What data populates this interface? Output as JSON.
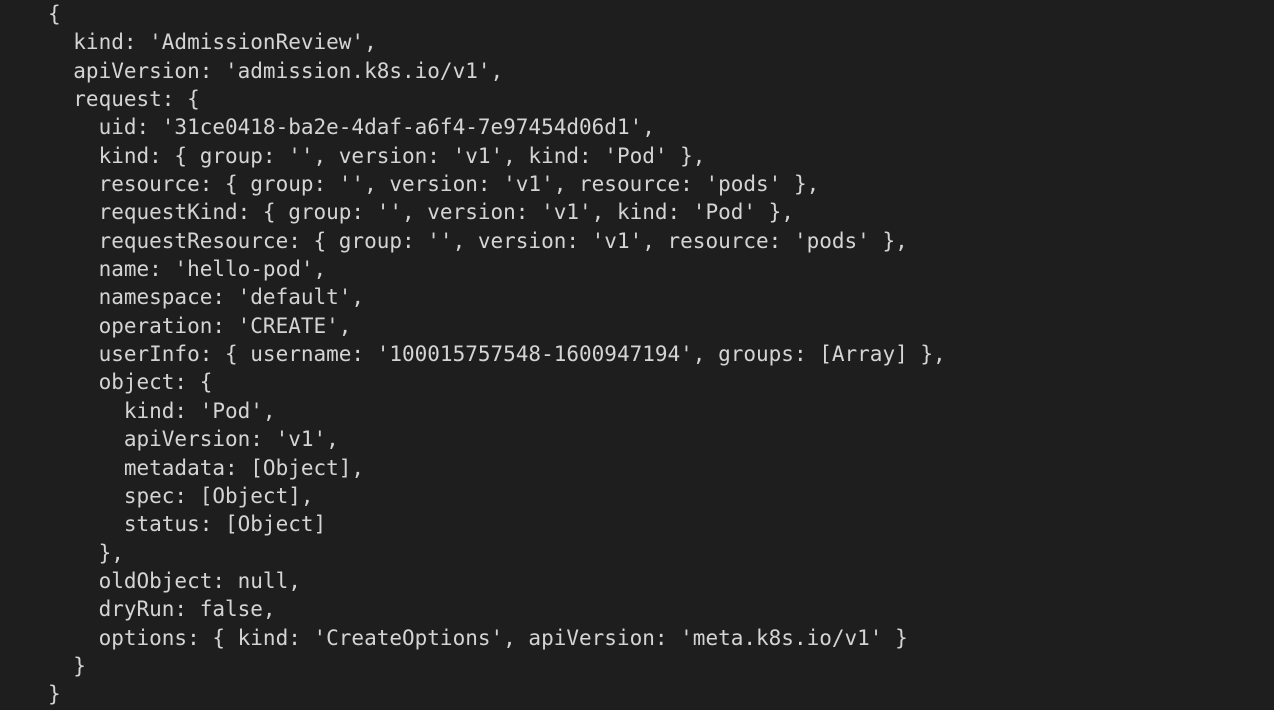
{
  "terminal": {
    "lines": [
      "{",
      "  kind: 'AdmissionReview',",
      "  apiVersion: 'admission.k8s.io/v1',",
      "  request: {",
      "    uid: '31ce0418-ba2e-4daf-a6f4-7e97454d06d1',",
      "    kind: { group: '', version: 'v1', kind: 'Pod' },",
      "    resource: { group: '', version: 'v1', resource: 'pods' },",
      "    requestKind: { group: '', version: 'v1', kind: 'Pod' },",
      "    requestResource: { group: '', version: 'v1', resource: 'pods' },",
      "    name: 'hello-pod',",
      "    namespace: 'default',",
      "    operation: 'CREATE',",
      "    userInfo: { username: '100015757548-1600947194', groups: [Array] },",
      "    object: {",
      "      kind: 'Pod',",
      "      apiVersion: 'v1',",
      "      metadata: [Object],",
      "      spec: [Object],",
      "      status: [Object]",
      "    },",
      "    oldObject: null,",
      "    dryRun: false,",
      "    options: { kind: 'CreateOptions', apiVersion: 'meta.k8s.io/v1' }",
      "  }",
      "}"
    ]
  }
}
